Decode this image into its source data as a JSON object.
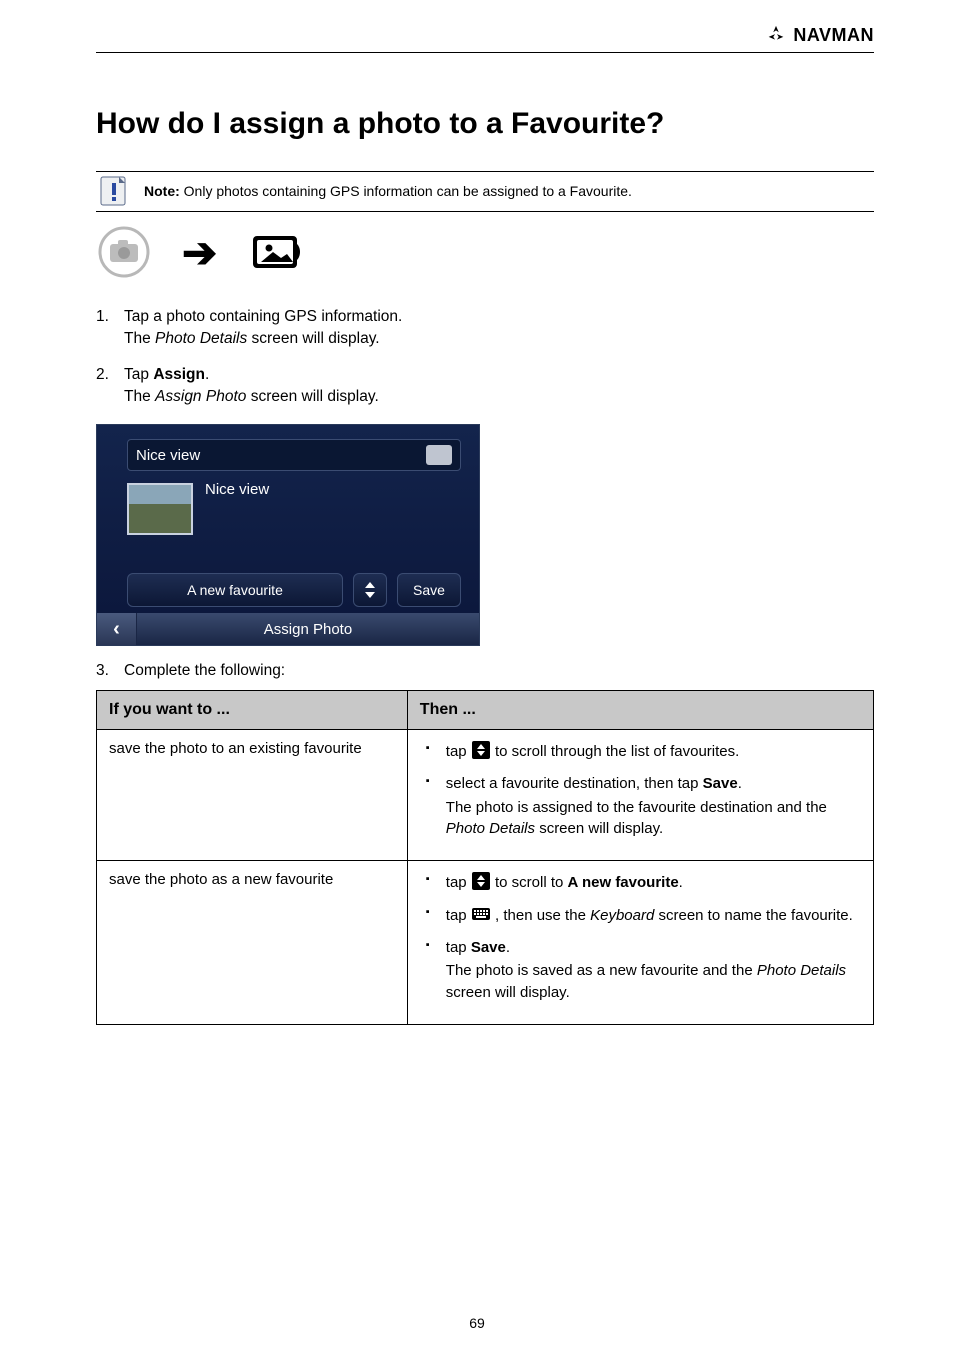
{
  "brand": {
    "name": "NAVMAN"
  },
  "title": "How do I assign a photo to a Favourite?",
  "note": {
    "prefix": "Note:",
    "text": "Only photos containing GPS information can be assigned to a Favourite."
  },
  "steps": {
    "s1_a": "Tap a photo containing GPS information.",
    "s1_b_prefix": "The",
    "s1_b_em": "Photo Details",
    "s1_b_suffix": "screen will display.",
    "s2_a": "Tap",
    "s2_b": "Assign",
    "s2_c_prefix": "The",
    "s2_c_em": "Assign Photo",
    "s2_c_suffix": "screen will display.",
    "s3": "Complete the following:"
  },
  "device": {
    "search_value": "Nice view",
    "result_title": "Nice view",
    "select_label": "A new favourite",
    "save_label": "Save",
    "footer_title": "Assign Photo"
  },
  "table": {
    "head_a": "If you want to ...",
    "head_b": "Then ...",
    "row1": {
      "want": "save the photo to an existing favourite",
      "b1a": "tap",
      "b1b": "to scroll through the list of favourites.",
      "b2a": "select a favourite destination, then tap",
      "b2b": "Save",
      "sub_prefix": "The photo is assigned to the favourite destination and the",
      "sub_em": "Photo Details",
      "sub_suffix": "screen will display."
    },
    "row2": {
      "want": "save the photo as a new favourite",
      "b1a": "tap",
      "b1b": "to scroll to",
      "b1c": "A new favourite",
      "b2a": "tap",
      "b2b": "then use the",
      "b2c": "Keyboard",
      "b2d": "screen to name the favourite.",
      "b3a": "tap",
      "b3b": "Save",
      "sub_prefix": "The photo is saved as a new favourite and the",
      "sub_em": "Photo Details",
      "sub_suffix": "screen will display."
    }
  },
  "page_number": "69"
}
